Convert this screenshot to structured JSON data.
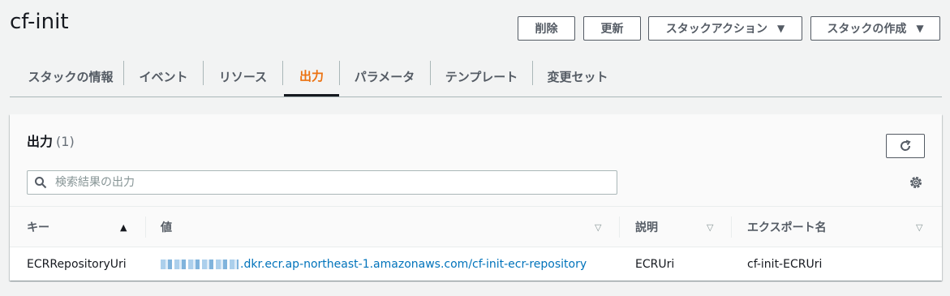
{
  "header": {
    "title": "cf-init",
    "buttons": {
      "delete": "削除",
      "update": "更新",
      "stack_actions": "スタックアクション",
      "create_stack": "スタックの作成"
    }
  },
  "tabs": [
    {
      "label": "スタックの情報"
    },
    {
      "label": "イベント"
    },
    {
      "label": "リソース"
    },
    {
      "label": "出力",
      "active": true
    },
    {
      "label": "パラメータ"
    },
    {
      "label": "テンプレート"
    },
    {
      "label": "変更セット"
    }
  ],
  "panel": {
    "title": "出力",
    "count": "(1)",
    "search_placeholder": "検索結果の出力",
    "columns": {
      "key": "キー",
      "value": "値",
      "description": "説明",
      "export_name": "エクスポート名"
    },
    "rows": [
      {
        "key": "ECRRepositoryUri",
        "value": ".dkr.ecr.ap-northeast-1.amazonaws.com/cf-init-ecr-repository",
        "description": "ECRUri",
        "export_name": "cf-init-ECRUri"
      }
    ]
  },
  "colors": {
    "accent": "#ec7211",
    "link": "#0073bb",
    "background": "#f2f3f3"
  },
  "icons": [
    "caret-down-icon",
    "refresh-icon",
    "search-icon",
    "gear-icon",
    "sort-asc-icon",
    "sort-desc-icon"
  ]
}
